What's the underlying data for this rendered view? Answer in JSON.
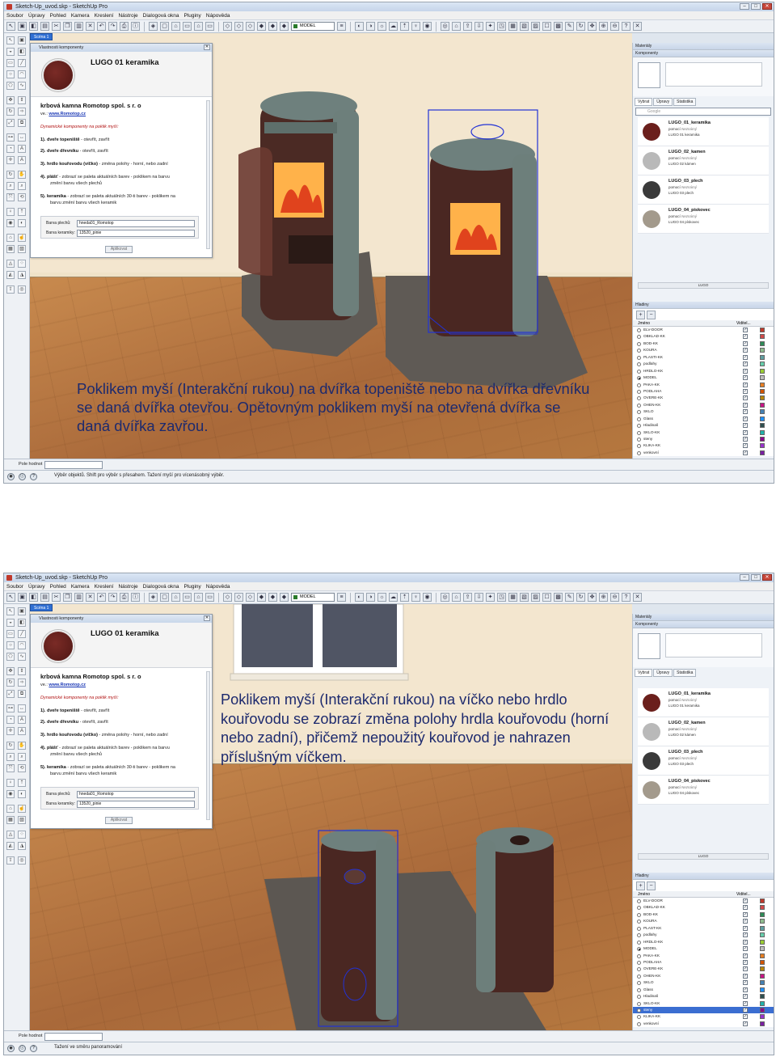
{
  "shots": [
    {
      "window_title": "Sketch-Up_uvod.skp - SketchUp Pro",
      "menu": [
        "Soubor",
        "Úpravy",
        "Pohled",
        "Kamera",
        "Kreslení",
        "Nástroje",
        "Dialogová okna",
        "Pluginy",
        "Nápověda"
      ],
      "layer_select": "MODEL",
      "scene_tab": "Scéna 1",
      "component_panel": {
        "title": "Vlastnosti komponenty",
        "name": "LUGO 01 keramika",
        "heading": "krbová kamna Romotop spol. s r. o",
        "www_prefix": "ve.: ",
        "www": "www.Romotop.cz",
        "note": "Dynamické komponenty na poklik myší:",
        "items": [
          {
            "num": "1). ",
            "label": "dveře topeniště",
            "rest": " - otevřít, zavřít"
          },
          {
            "num": "2). ",
            "label": "dveře dřevníku",
            "rest": " - otevřít, zavřít"
          },
          {
            "num": "3). ",
            "label": "hrdlo kouřovodu (víčko)",
            "rest": " - změna polohy - horní, nebo zadní"
          },
          {
            "num": "4). ",
            "label": "plášť",
            "rest": " - zobrazí se paleta aktuálních barev - poklikem na barvu",
            "rest2": "změní barvu všech plechů"
          },
          {
            "num": "5). ",
            "label": "keramika",
            "rest": " - zobrazí se paleta aktuálních 30-ti barev - poklikem na",
            "rest2": "barvu změní barvu všech keramik"
          }
        ],
        "fields": [
          {
            "label": "Barva plechů:",
            "value": "hneda01_Romotop"
          },
          {
            "label": "Barva keramiky:",
            "value": "13520_pinie"
          }
        ],
        "apply": "Aplikovat"
      },
      "caption": "Poklikem myší (Interakční rukou) na dvířka topeniště nebo na dvířka dřevníku se daná dvířka otevřou. Opětovným poklikem myší na otevřená dvířka se daná dvířka zavřou.",
      "materials": {
        "title": "Materiály",
        "sub": "Komponenty",
        "tabs": [
          "Vybrat",
          "Úpravy",
          "Statistika"
        ],
        "search_placeholder": "Google",
        "items": [
          {
            "name": "LUGO_01_keramika",
            "by": "pomocí ",
            "by_author": "Neznámý",
            "desc": "LUGO 01 keramika",
            "color": "#6b1f1c"
          },
          {
            "name": "LUGO_02_kamen",
            "by": "pomocí ",
            "by_author": "Neznámý",
            "desc": "LUGO 02 kámen",
            "color": "#b9b9b9"
          },
          {
            "name": "LUGO_03_plech",
            "by": "pomocí ",
            "by_author": "Neznámý",
            "desc": "LUGO 03 plech",
            "color": "#3a3a3a"
          },
          {
            "name": "LUGO_04_piskovec",
            "by": "pomocí ",
            "by_author": "Neznámý",
            "desc": "LUGO 04 pískovec",
            "color": "#a39a8c"
          }
        ],
        "footer": "LUGO"
      },
      "layers": {
        "title": "Hladiny",
        "col_name": "Jméno",
        "col_vis": "Viditel...",
        "rows": [
          {
            "name": "ELV-DOOR",
            "color": "#c0392b",
            "active": false
          },
          {
            "name": "OBKLAD-KK",
            "color": "#d04a4a",
            "active": false
          },
          {
            "name": "BOD-KK",
            "color": "#2e8b57",
            "active": false
          },
          {
            "name": "KOURA",
            "color": "#8fbc8f",
            "active": false
          },
          {
            "name": "PLASTI-KK",
            "color": "#5f9ea0",
            "active": false
          },
          {
            "name": "podlahy",
            "color": "#66cdaa",
            "active": false
          },
          {
            "name": "HRDLO-KK",
            "color": "#9acd32",
            "active": false
          },
          {
            "name": "MODEL",
            "color": "#bdbdbd",
            "active": true
          },
          {
            "name": "PAKA-KK",
            "color": "#e67e22",
            "active": false
          },
          {
            "name": "PODLAHA",
            "color": "#d35400",
            "active": false
          },
          {
            "name": "OVERE-KK",
            "color": "#b8860b",
            "active": false
          },
          {
            "name": "OHEN-KK",
            "color": "#c71585",
            "active": false
          },
          {
            "name": "SKLO",
            "color": "#4682b4",
            "active": false
          },
          {
            "name": "Glass",
            "color": "#1e90ff",
            "active": false
          },
          {
            "name": "Hladinaš",
            "color": "#2f4f4f",
            "active": false
          },
          {
            "name": "SKLO-KK",
            "color": "#20b2aa",
            "active": false
          },
          {
            "name": "steny",
            "color": "#8b008b",
            "active": false
          },
          {
            "name": "KLIKA-KK",
            "color": "#9932cc",
            "active": false
          },
          {
            "name": "venkovní",
            "color": "#7b1fa2",
            "active": false
          }
        ]
      },
      "measure_label": "Pole hodnot",
      "status": "Výběr objektů. Shift pro výběr s přesahem. Tažení myší pro vícenásobný výběr."
    },
    {
      "window_title": "Sketch-Up_uvod.skp - SketchUp Pro",
      "menu": [
        "Soubor",
        "Úpravy",
        "Pohled",
        "Kamera",
        "Kreslení",
        "Nástroje",
        "Dialogová okna",
        "Pluginy",
        "Nápověda"
      ],
      "layer_select": "MODEL",
      "scene_tab": "Scéna 1",
      "component_panel": {
        "title": "Vlastnosti komponenty",
        "name": "LUGO 01 keramika",
        "heading": "krbová kamna Romotop spol. s r. o",
        "www_prefix": "ve.: ",
        "www": "www.Romotop.cz",
        "note": "Dynamické komponenty na poklik myší:",
        "items": [
          {
            "num": "1). ",
            "label": "dveře topeniště",
            "rest": " - otevřít, zavřít"
          },
          {
            "num": "2). ",
            "label": "dveře dřevníku",
            "rest": " - otevřít, zavřít"
          },
          {
            "num": "3). ",
            "label": "hrdlo kouřovodu (víčko)",
            "rest": " - změna polohy - horní, nebo zadní"
          },
          {
            "num": "4). ",
            "label": "plášť",
            "rest": " - zobrazí se paleta aktuálních barev - poklikem na barvu",
            "rest2": "změní barvu všech plechů"
          },
          {
            "num": "5). ",
            "label": "keramika",
            "rest": " - zobrazí se paleta aktuálních 30-ti barev - poklikem na",
            "rest2": "barvu změní barvu všech keramik"
          }
        ],
        "fields": [
          {
            "label": "Barva plechů:",
            "value": "hneda01_Romotop"
          },
          {
            "label": "Barva keramiky:",
            "value": "13520_pinie"
          }
        ],
        "apply": "Aplikovat"
      },
      "caption": "Poklikem myší (Interakční rukou) na víčko nebo hrdlo kouřovodu se zobrazí změna polohy hrdla kouřovodu (horní nebo zadní), přičemž nepoužitý kouřovod je nahrazen příslušným víčkem.",
      "materials": {
        "title": "Materiály",
        "sub": "Komponenty",
        "tabs": [
          "Vybrat",
          "Úpravy",
          "Statistika"
        ],
        "search_placeholder": "",
        "items": [
          {
            "name": "LUGO_01_keramika",
            "by": "pomocí ",
            "by_author": "Neznámý",
            "desc": "LUGO 01 keramika",
            "color": "#6b1f1c"
          },
          {
            "name": "LUGO_02_kamen",
            "by": "pomocí ",
            "by_author": "Neznámý",
            "desc": "LUGO 02 kámen",
            "color": "#b9b9b9"
          },
          {
            "name": "LUGO_03_plech",
            "by": "pomocí ",
            "by_author": "Neznámý",
            "desc": "LUGO 03 plech",
            "color": "#3a3a3a"
          },
          {
            "name": "LUGO_04_piskovec",
            "by": "pomocí ",
            "by_author": "Neznámý",
            "desc": "LUGO 04 pískovec",
            "color": "#a39a8c"
          }
        ],
        "footer": "LUGO"
      },
      "layers": {
        "title": "Hladiny",
        "col_name": "Jméno",
        "col_vis": "Viditel...",
        "rows": [
          {
            "name": "ELV-DOOR",
            "color": "#c0392b",
            "active": false
          },
          {
            "name": "OBKLAD-KK",
            "color": "#d04a4a",
            "active": false
          },
          {
            "name": "BOD-KK",
            "color": "#2e8b57",
            "active": false
          },
          {
            "name": "KOURA",
            "color": "#8fbc8f",
            "active": false
          },
          {
            "name": "PLAST-KK",
            "color": "#5f9ea0",
            "active": false
          },
          {
            "name": "podlahy",
            "color": "#66cdaa",
            "active": false
          },
          {
            "name": "HRDLO-KK",
            "color": "#9acd32",
            "active": false
          },
          {
            "name": "MODEL",
            "color": "#bdbdbd",
            "active": true
          },
          {
            "name": "PAKA-KK",
            "color": "#e67e22",
            "active": false
          },
          {
            "name": "PODLAHA",
            "color": "#d35400",
            "active": false
          },
          {
            "name": "OVERE-KK",
            "color": "#b8860b",
            "active": false
          },
          {
            "name": "OHEN-KK",
            "color": "#c71585",
            "active": false
          },
          {
            "name": "SKLO",
            "color": "#4682b4",
            "active": false
          },
          {
            "name": "Glass",
            "color": "#1e90ff",
            "active": false
          },
          {
            "name": "Hladinaš",
            "color": "#2f4f4f",
            "active": false
          },
          {
            "name": "SKLO-KK",
            "color": "#20b2aa",
            "active": false
          },
          {
            "name": "steny",
            "color": "#8b008b",
            "active": false,
            "selected": true
          },
          {
            "name": "KLIKA-KK",
            "color": "#9932cc",
            "active": false
          },
          {
            "name": "venkovní",
            "color": "#7b1fa2",
            "active": false
          }
        ]
      },
      "measure_label": "Pole hodnot",
      "status": "Tažení ve směru panoramování"
    }
  ]
}
